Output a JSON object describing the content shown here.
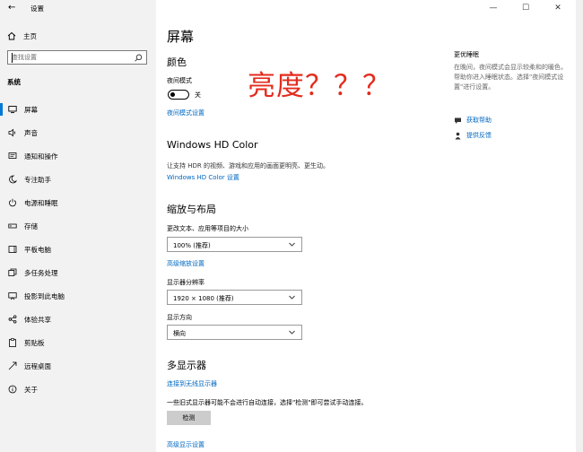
{
  "window": {
    "title": "设置",
    "controls": {
      "minimize": "—",
      "maximize": "☐",
      "close": "✕"
    }
  },
  "sidebar": {
    "home_label": "主页",
    "search_placeholder": "查找设置",
    "section_label": "系统",
    "items": [
      {
        "label": "屏幕",
        "icon": "monitor-icon",
        "active": true
      },
      {
        "label": "声音",
        "icon": "speaker-icon"
      },
      {
        "label": "通知和操作",
        "icon": "notification-icon"
      },
      {
        "label": "专注助手",
        "icon": "moon-icon"
      },
      {
        "label": "电源和睡眠",
        "icon": "power-icon"
      },
      {
        "label": "存储",
        "icon": "storage-icon"
      },
      {
        "label": "平板电脑",
        "icon": "tablet-icon"
      },
      {
        "label": "多任务处理",
        "icon": "multitasking-icon"
      },
      {
        "label": "投影到此电脑",
        "icon": "projection-icon"
      },
      {
        "label": "体验共享",
        "icon": "share-icon"
      },
      {
        "label": "剪贴板",
        "icon": "clipboard-icon"
      },
      {
        "label": "远程桌面",
        "icon": "remote-desktop-icon"
      },
      {
        "label": "关于",
        "icon": "info-icon"
      }
    ]
  },
  "main": {
    "page_title": "屏幕",
    "color_heading": "颜色",
    "night_mode_label": "夜间模式",
    "night_mode_state": "关",
    "night_mode_settings_link": "夜间模式设置",
    "hdr_heading": "Windows HD Color",
    "hdr_description": "让支持 HDR 的视频、游戏和应用的画面更明亮、更生动。",
    "hdr_settings_link": "Windows HD Color 设置",
    "scale_heading": "缩放与布局",
    "scale_label": "更改文本、应用等项目的大小",
    "scale_value": "100% (推荐)",
    "advanced_scale_link": "高级缩放设置",
    "resolution_label": "显示器分辨率",
    "resolution_value": "1920 × 1080 (推荐)",
    "orientation_label": "显示方向",
    "orientation_value": "横向",
    "multi_display_heading": "多显示器",
    "wireless_link": "连接到无线显示器",
    "detect_description": "一些旧式显示器可能不会进行自动连接，选择\"检测\"即可尝试手动连接。",
    "detect_button": "检测",
    "advanced_display_link": "高级显示设置"
  },
  "annotation": {
    "text": "亮度？？？",
    "color": "#e32b1d"
  },
  "help_pane": {
    "title": "更优睡眠",
    "description": "在晚间，夜间模式会显示较柔和的暖色，帮助你进入睡眠状态。选择\"夜间模式设置\"进行设置。",
    "get_help_link": "获取帮助",
    "feedback_link": "提供反馈"
  },
  "colors": {
    "accent": "#0078d7",
    "link": "#0067c0",
    "sidebar_bg": "#f2f2f2"
  }
}
